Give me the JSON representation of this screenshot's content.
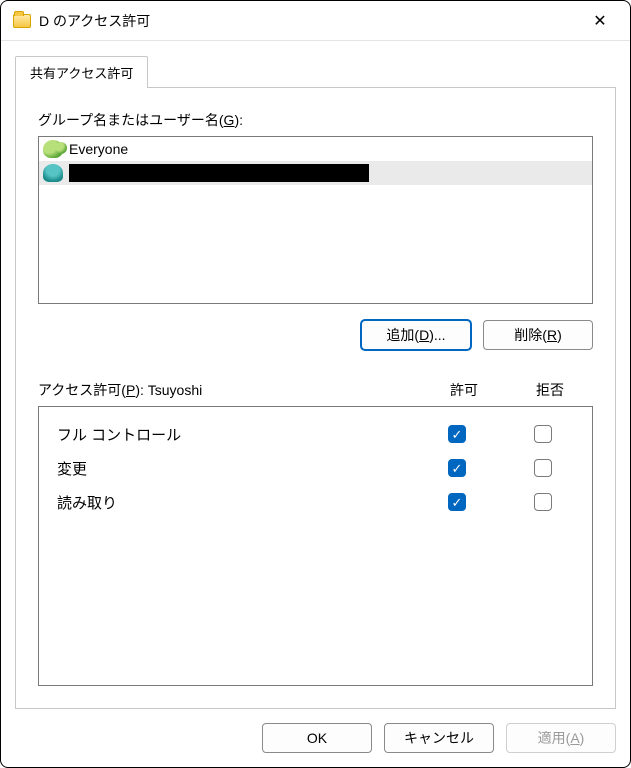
{
  "window": {
    "title": "D のアクセス許可"
  },
  "tab": {
    "label": "共有アクセス許可"
  },
  "groups": {
    "label_pre": "グループ名またはユーザー名(",
    "label_key": "G",
    "label_post": "):"
  },
  "users": [
    {
      "name": "Everyone",
      "icon": "group",
      "selected": false,
      "redacted": false
    },
    {
      "name": "",
      "icon": "user",
      "selected": true,
      "redacted": true
    }
  ],
  "buttons": {
    "add_pre": "追加(",
    "add_key": "D",
    "add_post": ")...",
    "remove_pre": "削除(",
    "remove_key": "R",
    "remove_post": ")"
  },
  "perm": {
    "label_pre": "アクセス許可(",
    "label_key": "P",
    "label_post": "): ",
    "subject": "Tsuyoshi",
    "col_allow": "許可",
    "col_deny": "拒否",
    "rows": [
      {
        "name": "フル コントロール",
        "allow": true,
        "deny": false
      },
      {
        "name": "変更",
        "allow": true,
        "deny": false
      },
      {
        "name": "読み取り",
        "allow": true,
        "deny": false
      }
    ]
  },
  "footer": {
    "ok": "OK",
    "cancel": "キャンセル",
    "apply_pre": "適用(",
    "apply_key": "A",
    "apply_post": ")"
  }
}
